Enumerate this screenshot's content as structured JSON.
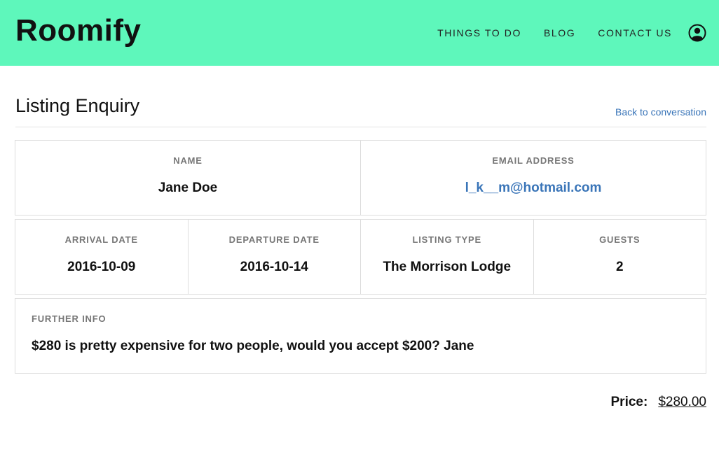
{
  "brand": {
    "name": "Roomify"
  },
  "nav": {
    "items": [
      "THINGS TO DO",
      "BLOG",
      "CONTACT US"
    ],
    "user_icon": "user-circle-icon"
  },
  "page": {
    "title": "Listing Enquiry",
    "back_link": "Back to conversation"
  },
  "contact": {
    "name_label": "NAME",
    "name": "Jane Doe",
    "email_label": "EMAIL ADDRESS",
    "email": "l_k__m@hotmail.com"
  },
  "booking": {
    "arrival_label": "ARRIVAL DATE",
    "arrival": "2016-10-09",
    "departure_label": "DEPARTURE DATE",
    "departure": "2016-10-14",
    "listing_type_label": "LISTING TYPE",
    "listing_type": "The Morrison Lodge",
    "guests_label": "GUESTS",
    "guests": "2"
  },
  "further_info": {
    "label": "FURTHER INFO",
    "text": "$280 is pretty expensive for two people, would you accept $200? Jane"
  },
  "price": {
    "label": "Price:",
    "value": "$280.00"
  },
  "colors": {
    "header_bg": "#5ef7bb",
    "link": "#3a75b8"
  }
}
